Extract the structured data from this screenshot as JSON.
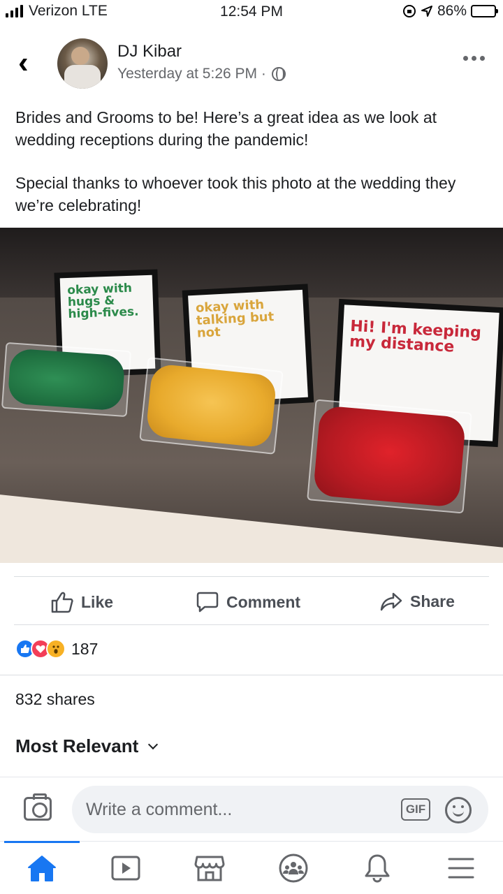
{
  "status_bar": {
    "carrier": "Verizon LTE",
    "time": "12:54 PM",
    "battery_text": "86%",
    "battery_level": 0.86
  },
  "post": {
    "author": "DJ Kibar",
    "timestamp": "Yesterday at 5:26 PM ·",
    "paragraphs": [
      "Brides and Grooms to be! Here’s a great idea as we look at wedding receptions during the pandemic!",
      "Special thanks to whoever took this photo at the wedding they we’re celebrating!"
    ],
    "photo_signs": {
      "green": "okay with hugs & high-fives.",
      "yellow": "okay with talking but not",
      "red": "Hi! I'm keeping my distance"
    }
  },
  "actions": {
    "like": "Like",
    "comment": "Comment",
    "share": "Share"
  },
  "engagement": {
    "reaction_count": "187",
    "reactions": [
      "like",
      "love",
      "wow"
    ],
    "shares": "832 shares",
    "sort_label": "Most Relevant"
  },
  "comment_bar": {
    "placeholder": "Write a comment...",
    "gif_label": "GIF"
  },
  "tabs": [
    "home-icon",
    "watch-icon",
    "marketplace-icon",
    "groups-icon",
    "notifications-icon",
    "menu-icon"
  ],
  "colors": {
    "accent": "#1877f2",
    "love": "#f33e58",
    "wow": "#f7b125",
    "icon_gray": "#65676b"
  }
}
